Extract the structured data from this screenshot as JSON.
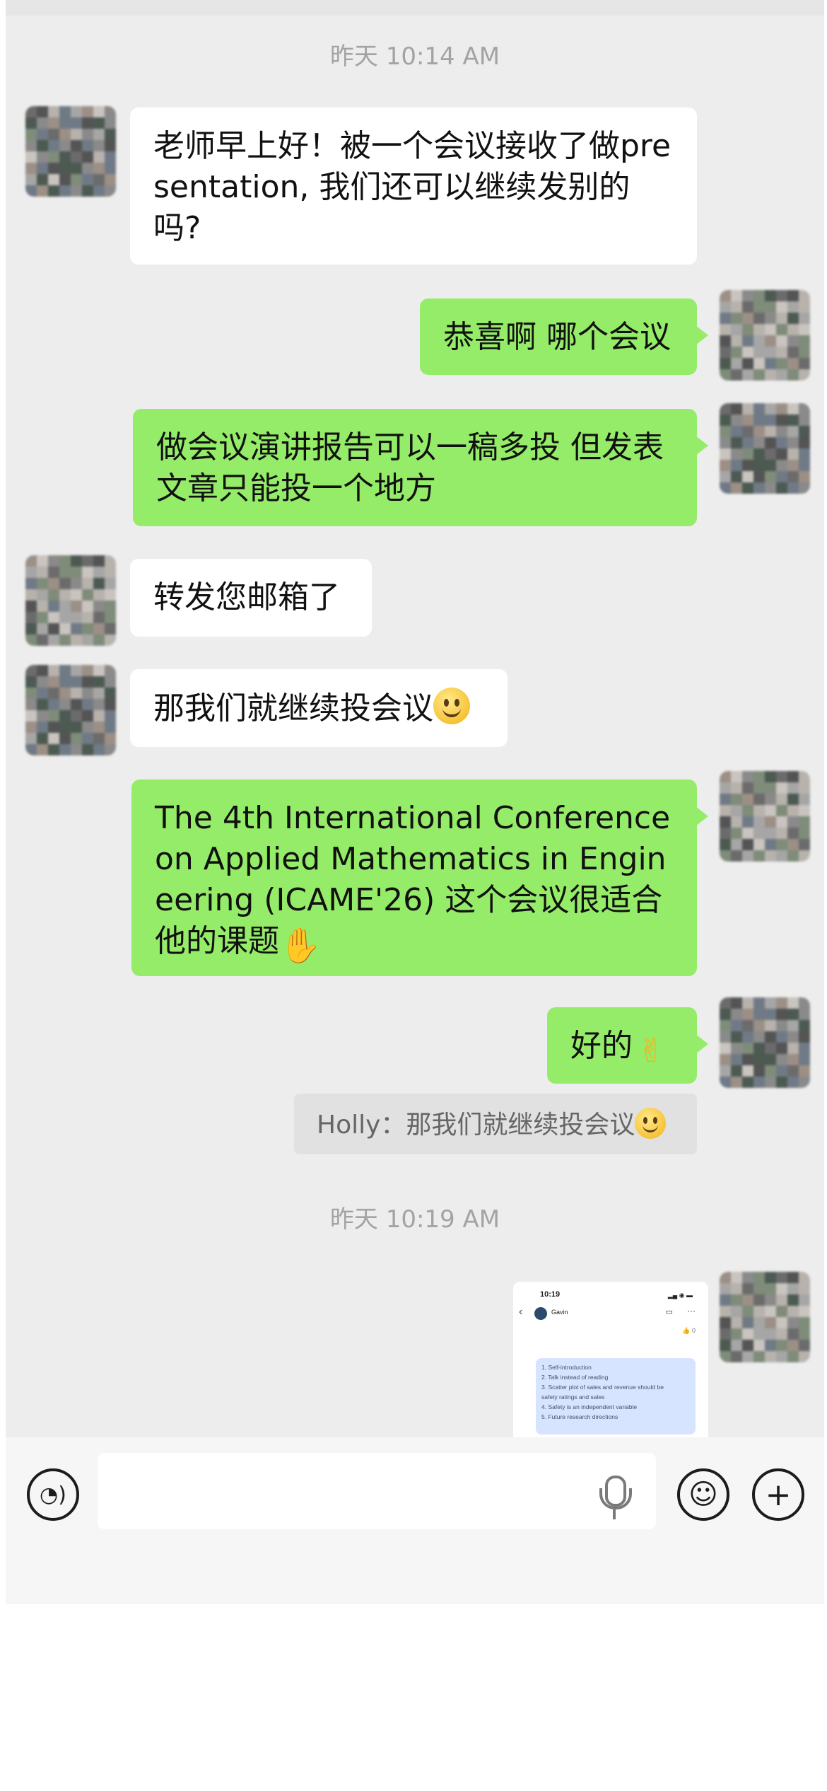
{
  "timestamps": {
    "first": "昨天 10:14 AM",
    "second": "昨天 10:19 AM"
  },
  "messages": [
    {
      "side": "in",
      "text": "老师早上好！被一个会议接收了做presentation, 我们还可以继续发别的吗?"
    },
    {
      "side": "out",
      "text": "恭喜啊 哪个会议"
    },
    {
      "side": "out",
      "text": "做会议演讲报告可以一稿多投 但发表文章只能投一个地方"
    },
    {
      "side": "in",
      "text": "转发您邮箱了"
    },
    {
      "side": "in",
      "text": "那我们就继续投会议"
    },
    {
      "side": "out",
      "text": "The 4th International Conference on Applied Mathematics in Engineering (ICAME'26) 这个会议很适合他的课题"
    },
    {
      "side": "out",
      "text": "好的"
    }
  ],
  "quote": {
    "text": "Holly：那我们就继续投会议"
  },
  "image_message": {
    "time": "10:19",
    "contact": "Gavin",
    "reaction": "👍 0",
    "list": [
      "1. Self-introduction",
      "2. Talk instead of reading",
      "3. Scatter plot of sales and revenue should be",
      "safety ratings and sales",
      "4. Safety is an independent variable",
      "5. Future research directions"
    ]
  },
  "input_bar": {
    "icons": [
      "voice-icon",
      "microphone-icon",
      "emoji-icon",
      "plus-icon"
    ]
  },
  "colors": {
    "background": "#ededed",
    "incoming_bubble": "#ffffff",
    "outgoing_bubble": "#95ec69",
    "timestamp": "#a3a3a3"
  }
}
